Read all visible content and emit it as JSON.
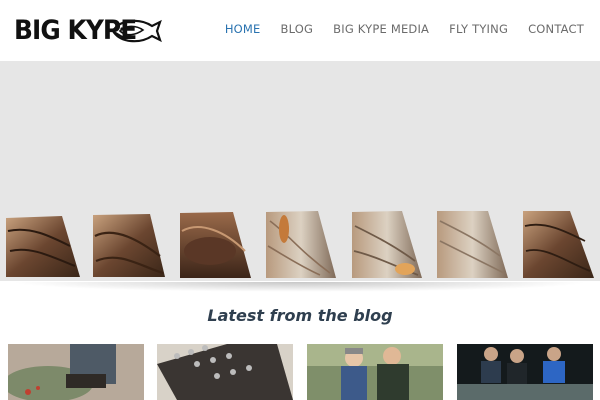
{
  "header": {
    "logo_text": "BIG KYPE",
    "nav": [
      {
        "label": "HOME",
        "active": true
      },
      {
        "label": "BLOG",
        "active": false
      },
      {
        "label": "BIG KYPE MEDIA",
        "active": false
      },
      {
        "label": "FLY TYING",
        "active": false
      },
      {
        "label": "CONTACT",
        "active": false
      }
    ]
  },
  "colors": {
    "nav_active": "#2a73b0",
    "nav_default": "#6b6b6b",
    "slider_bg": "#e6e6e6",
    "section_title": "#2f3f4f"
  },
  "slider": {
    "tile_count": 7
  },
  "blog": {
    "section_title": "Latest from the blog"
  }
}
